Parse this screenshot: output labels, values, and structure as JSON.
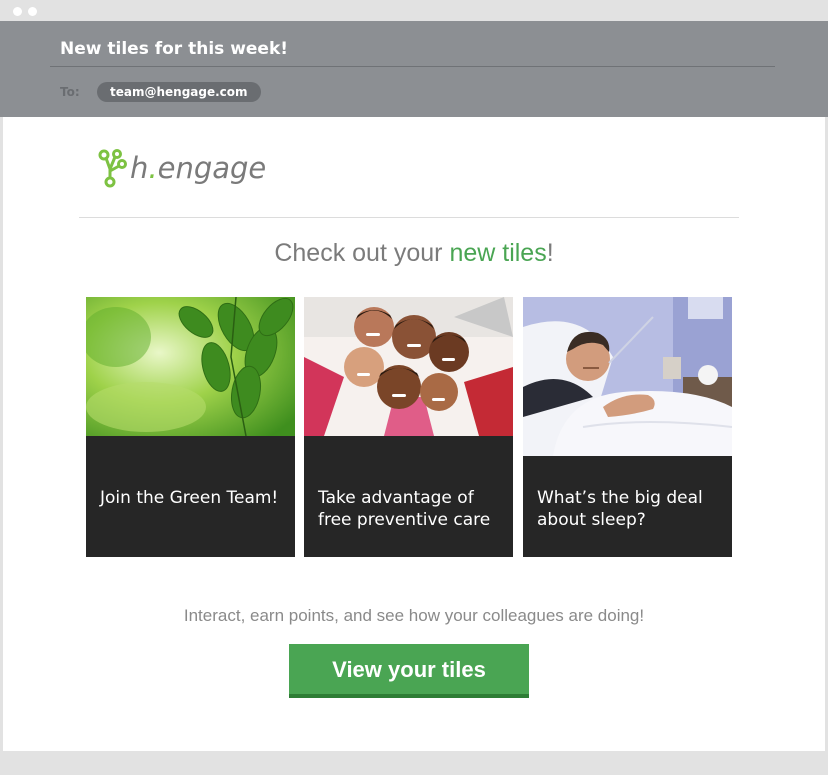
{
  "email": {
    "subject": "New tiles for this week!",
    "to_label": "To:",
    "to_address": "team@hengage.com"
  },
  "brand": {
    "logo_h": "h",
    "logo_dot": ".",
    "logo_rest": "engage",
    "green": "#4aa553",
    "logo_green": "#7dc242"
  },
  "headline": {
    "prefix": "Check out your ",
    "highlight": "new tiles",
    "suffix": "!"
  },
  "tiles": [
    {
      "label": "Join the Green Team!",
      "image": "green-leaves-photo"
    },
    {
      "label": "Take advantage of free preventive care",
      "image": "children-circle-photo"
    },
    {
      "label": "What’s the big deal about sleep?",
      "image": "sick-man-in-bed-photo"
    }
  ],
  "cta": {
    "text": "Interact, earn points, and see how your colleagues are doing!",
    "button_label": "View your tiles"
  }
}
